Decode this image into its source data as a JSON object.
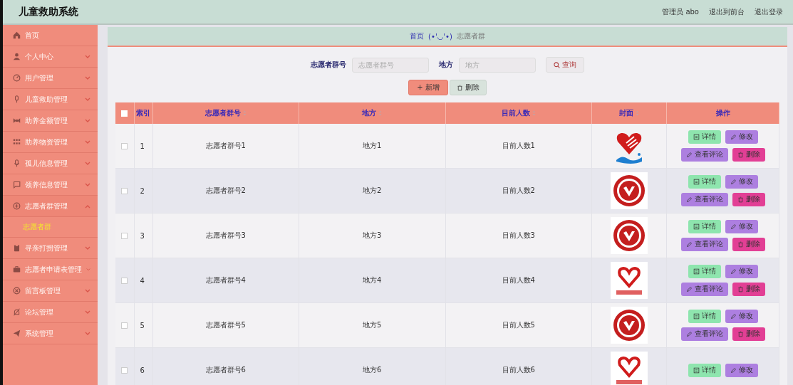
{
  "header": {
    "title": "儿童救助系统",
    "links": [
      "管理员 abo",
      "退出到前台",
      "退出登录"
    ]
  },
  "sidebar": {
    "items": [
      {
        "label": "首页",
        "kind": "link"
      },
      {
        "label": "个人中心",
        "kind": "menu",
        "expanded": false
      },
      {
        "label": "用户管理",
        "kind": "menu",
        "expanded": false
      },
      {
        "label": "儿童救助管理",
        "kind": "menu",
        "expanded": false
      },
      {
        "label": "助养金额管理",
        "kind": "menu",
        "expanded": false
      },
      {
        "label": "助养物资管理",
        "kind": "menu",
        "expanded": false
      },
      {
        "label": "孤儿信息管理",
        "kind": "menu",
        "expanded": false
      },
      {
        "label": "领养信息管理",
        "kind": "menu",
        "expanded": false
      },
      {
        "label": "志愿者群管理",
        "kind": "menu",
        "expanded": true,
        "children": [
          {
            "label": "志愿者群",
            "selected": true
          }
        ]
      },
      {
        "label": "寻亲打拐管理",
        "kind": "menu",
        "expanded": false
      },
      {
        "label": "志愿者申请表管理",
        "kind": "menu",
        "expanded": false
      },
      {
        "label": "留言板管理",
        "kind": "menu",
        "expanded": false
      },
      {
        "label": "论坛管理",
        "kind": "menu",
        "expanded": false
      },
      {
        "label": "系统管理",
        "kind": "menu",
        "expanded": false
      }
    ]
  },
  "breadcrumb": {
    "home": "首页",
    "separator": "(•'◡'•)",
    "current": "志愿者群"
  },
  "search": {
    "fields": [
      {
        "label": "志愿者群号",
        "placeholder": "志愿者群号"
      },
      {
        "label": "地方",
        "placeholder": "地方"
      }
    ],
    "button": "查询"
  },
  "toolbar": {
    "add": "+ 新增",
    "delete": "删除"
  },
  "table": {
    "all_checked": false,
    "columns": [
      {
        "label": "索引",
        "sortable": false
      },
      {
        "label": "志愿者群号",
        "sortable": true
      },
      {
        "label": "地方",
        "sortable": true
      },
      {
        "label": "目前人数",
        "sortable": true
      },
      {
        "label": "封面",
        "sortable": true
      },
      {
        "label": "操作",
        "sortable": false
      }
    ],
    "rows": [
      {
        "checked": false,
        "index": "1",
        "group": "志愿者群号1",
        "place": "地方1",
        "count": "目前人数1",
        "cover": {
          "kind": "heart-wave"
        },
        "actions": [
          "详情",
          "修改",
          "查看评论",
          "删除"
        ]
      },
      {
        "checked": false,
        "index": "2",
        "group": "志愿者群号2",
        "place": "地方2",
        "count": "目前人数2",
        "cover": {
          "kind": "seal"
        },
        "actions": [
          "详情",
          "修改",
          "查看评论",
          "删除"
        ]
      },
      {
        "checked": false,
        "index": "3",
        "group": "志愿者群号3",
        "place": "地方3",
        "count": "目前人数3",
        "cover": {
          "kind": "seal"
        },
        "actions": [
          "详情",
          "修改",
          "查看评论",
          "删除"
        ]
      },
      {
        "checked": false,
        "index": "4",
        "group": "志愿者群号4",
        "place": "地方4",
        "count": "目前人数4",
        "cover": {
          "kind": "heart-plain"
        },
        "actions": [
          "详情",
          "修改",
          "查看评论",
          "删除"
        ]
      },
      {
        "checked": false,
        "index": "5",
        "group": "志愿者群号5",
        "place": "地方5",
        "count": "目前人数5",
        "cover": {
          "kind": "seal"
        },
        "actions": [
          "详情",
          "修改",
          "查看评论",
          "删除"
        ]
      },
      {
        "checked": false,
        "index": "6",
        "group": "志愿者群号6",
        "place": "地方6",
        "count": "目前人数6",
        "cover": {
          "kind": "heart-plain"
        },
        "actions": [
          "详情",
          "修改"
        ]
      }
    ]
  }
}
